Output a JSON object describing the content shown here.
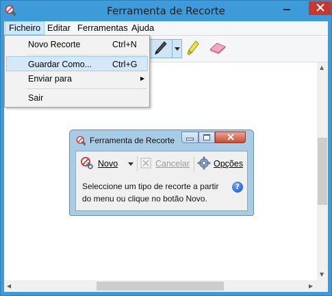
{
  "window": {
    "title": "Ferramenta de Recorte",
    "controls": {
      "minimize": "—",
      "maximize": "☐",
      "close": "✕"
    }
  },
  "menubar": {
    "items": [
      {
        "label": "Ficheiro",
        "active": true
      },
      {
        "label": "Editar"
      },
      {
        "label": "Ferramentas"
      },
      {
        "label": "Ajuda"
      }
    ]
  },
  "file_menu": {
    "items": [
      {
        "label": "Novo Recorte",
        "shortcut": "Ctrl+N"
      },
      {
        "label": "Guardar Como...",
        "shortcut": "Ctrl+G",
        "highlighted": true
      },
      {
        "label": "Enviar para",
        "submenu": "▶"
      },
      {
        "label": "Sair"
      }
    ]
  },
  "toolbar": {
    "tools": [
      "pen-icon",
      "dropdown-arrow-icon",
      "highlighter-icon",
      "eraser-icon"
    ]
  },
  "dialog": {
    "title": "Ferramenta de Recorte",
    "new_label": "Novo",
    "cancel_label": "Cancelar",
    "options_label": "Opções",
    "message": "Seleccione um tipo de recorte a partir do menu ou clique no botão Novo.",
    "help": "?"
  },
  "colors": {
    "frame": "#3d9bd9",
    "close_button": "#c7372f",
    "menu_highlight": "#cce8ff",
    "dialog_frame": "#a8cbe6"
  }
}
